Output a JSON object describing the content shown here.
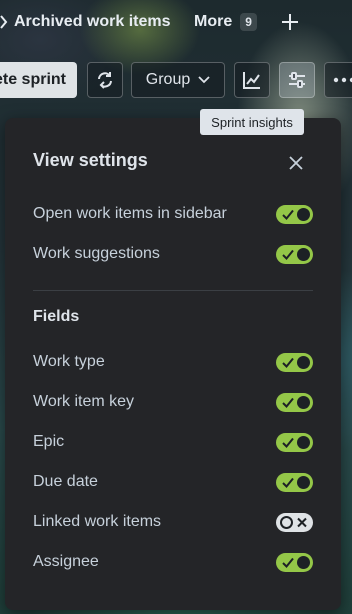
{
  "header": {
    "archived_label": "Archived work items",
    "more_label": "More",
    "more_count": "9",
    "add_icon": "plus-icon"
  },
  "toolbar": {
    "complete_sprint_label": "ete sprint",
    "group_label": "Group",
    "tooltip": "Sprint insights"
  },
  "view_settings": {
    "title": "View settings",
    "general": [
      {
        "label": "Open work items in sidebar",
        "on": true
      },
      {
        "label": "Work suggestions",
        "on": true
      }
    ],
    "fields_heading": "Fields",
    "fields": [
      {
        "label": "Work type",
        "on": true
      },
      {
        "label": "Work item key",
        "on": true
      },
      {
        "label": "Epic",
        "on": true
      },
      {
        "label": "Due date",
        "on": true
      },
      {
        "label": "Linked work items",
        "on": false
      },
      {
        "label": "Assignee",
        "on": true
      }
    ]
  },
  "colors": {
    "toggle_on": "#94c748",
    "toggle_off": "#dfe3e6",
    "panel_bg": "#242528",
    "tooltip_bg": "#dfe4ea"
  }
}
